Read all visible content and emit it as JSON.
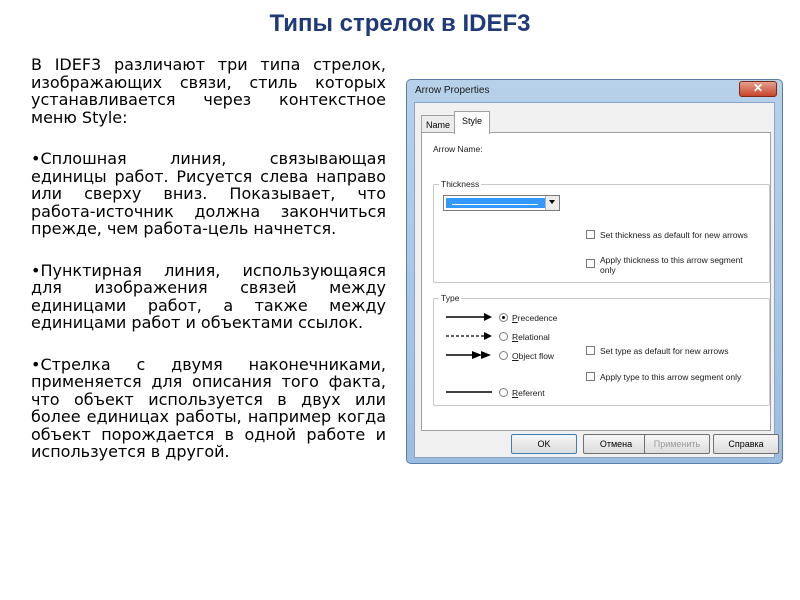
{
  "slide": {
    "title": "Типы стрелок в IDEF3",
    "paragraphs": [
      "В IDEF3 различают три типа стрелок, изображающих связи, стиль которых устанавливается через контекстное меню Style:",
      "•Сплошная линия, связывающая единицы работ. Рисуется слева направо или сверху вниз. Показывает, что работа-источник должна закончиться прежде, чем работа-цель начнется.",
      "•Пунктирная линия, использующаяся для изображения связей между единицами работ, а также между единицами работ и объектами ссылок.",
      "•Стрелка с двумя наконечниками, применяется для описания того факта, что объект используется в двух или более единицах работы, например когда объект порождается в одной работе и используется в другой."
    ]
  },
  "dialog": {
    "title": "Arrow Properties",
    "close_glyph": "✕",
    "tabs": {
      "name": "Name",
      "style": "Style"
    },
    "arrow_name_label": "Arrow Name:",
    "thickness": {
      "legend": "Thickness",
      "default_check": "Set thickness as default for new arrows",
      "apply_check_line1": "Apply thickness to this arrow segment",
      "apply_check_line2": "only"
    },
    "type": {
      "legend": "Type",
      "options": {
        "precedence": "Precedence",
        "relational": "Relational",
        "object_flow": "Object flow",
        "referent": "Referent"
      },
      "selected": "Precedence",
      "default_check": "Set type as default for new arrows",
      "apply_check": "Apply type to this arrow segment only"
    },
    "buttons": {
      "ok": "OK",
      "cancel": "Отмена",
      "apply": "Применить",
      "help": "Справка"
    }
  }
}
